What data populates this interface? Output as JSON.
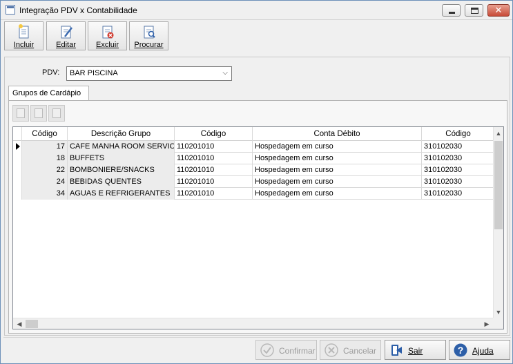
{
  "window": {
    "title": "Integração PDV x Contabilidade",
    "close_glyph": "✕"
  },
  "toolbar": {
    "buttons": [
      {
        "label": "Incluir",
        "icon": "new-document-icon"
      },
      {
        "label": "Editar",
        "icon": "edit-document-icon"
      },
      {
        "label": "Excluir",
        "icon": "delete-document-icon"
      },
      {
        "label": "Procurar",
        "icon": "search-document-icon"
      }
    ]
  },
  "form": {
    "pdv_label": "PDV:",
    "pdv_value": "BAR PISCINA",
    "dropdown_glyph": "⌵"
  },
  "tabs": [
    {
      "label": "Grupos de Cardápio",
      "active": true
    }
  ],
  "grid": {
    "columns": [
      "Código",
      "Descrição Grupo",
      "Código",
      "Conta Débito",
      "Código"
    ],
    "rows": [
      {
        "codigo": "17",
        "descricao": "CAFE MANHA ROOM SERVICE",
        "cod_debito": "110201010",
        "conta_debito": "Hospedagem em curso",
        "cod_credito": "310102030",
        "current": true
      },
      {
        "codigo": "18",
        "descricao": "BUFFETS",
        "cod_debito": "110201010",
        "conta_debito": "Hospedagem em curso",
        "cod_credito": "310102030",
        "current": false
      },
      {
        "codigo": "22",
        "descricao": "BOMBONIERE/SNACKS",
        "cod_debito": "110201010",
        "conta_debito": "Hospedagem em curso",
        "cod_credito": "310102030",
        "current": false
      },
      {
        "codigo": "24",
        "descricao": "BEBIDAS QUENTES",
        "cod_debito": "110201010",
        "conta_debito": "Hospedagem em curso",
        "cod_credito": "310102030",
        "current": false
      },
      {
        "codigo": "34",
        "descricao": "AGUAS E REFRIGERANTES",
        "cod_debito": "110201010",
        "conta_debito": "Hospedagem em curso",
        "cod_credito": "310102030",
        "current": false
      }
    ]
  },
  "actions": {
    "confirmar": "Confirmar",
    "cancelar": "Cancelar",
    "sair": "Sair",
    "ajuda": "Ajuda"
  },
  "colors": {
    "help_blue": "#2d5fa8",
    "close_red": "#c74a38"
  }
}
